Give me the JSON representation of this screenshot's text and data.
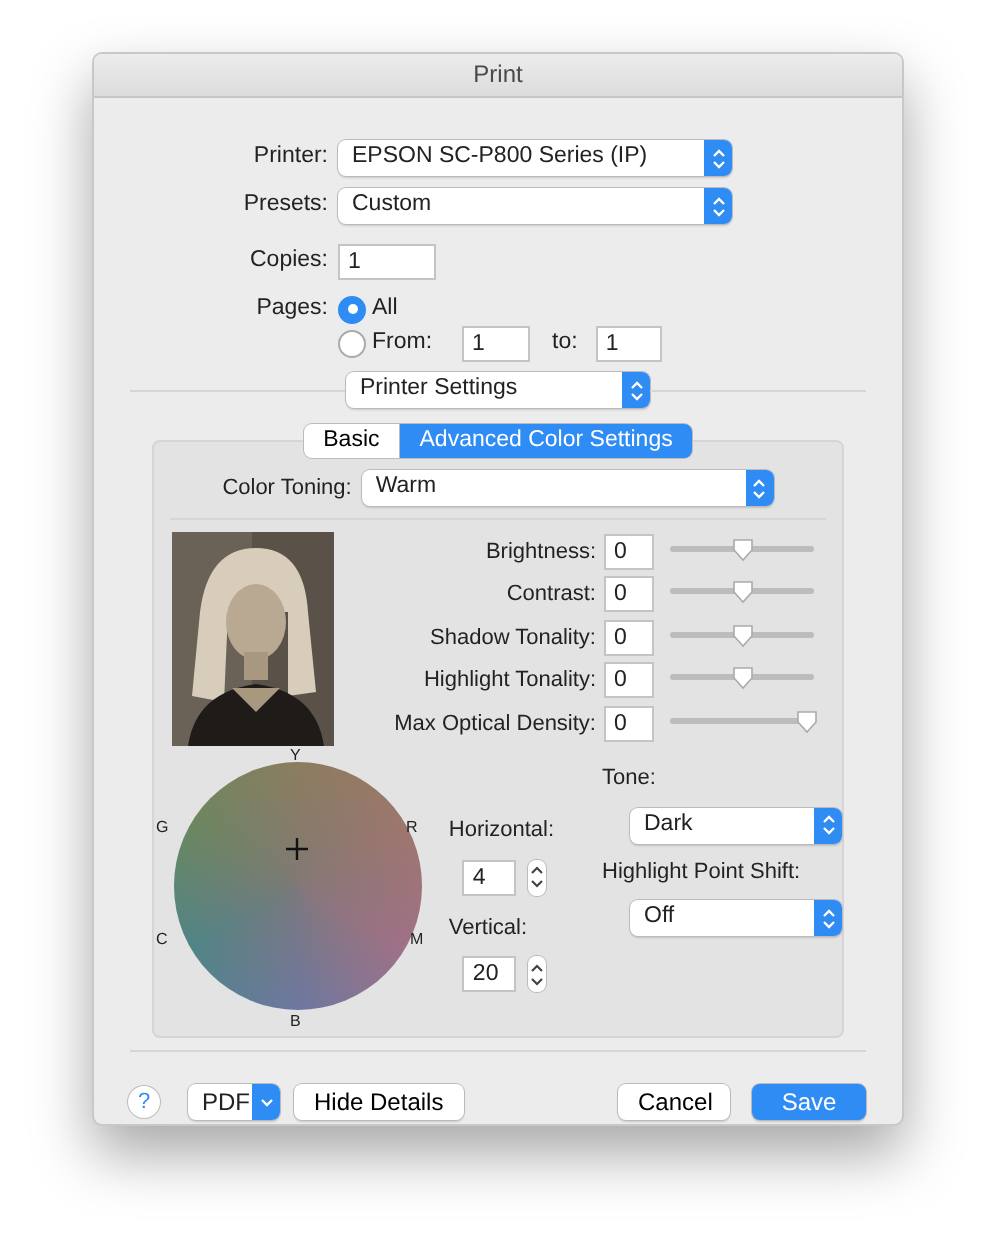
{
  "window": {
    "title": "Print"
  },
  "printer": {
    "label": "Printer:",
    "value": "EPSON SC-P800 Series (IP)"
  },
  "presets": {
    "label": "Presets:",
    "value": "Custom"
  },
  "copies": {
    "label": "Copies:",
    "value": "1"
  },
  "pages": {
    "label": "Pages:",
    "options": [
      {
        "label": "All",
        "selected": true
      },
      {
        "label": "From:",
        "selected": false
      }
    ],
    "from": "1",
    "to_label": "to:",
    "to": "1"
  },
  "section_menu": {
    "value": "Printer Settings"
  },
  "tabs": [
    {
      "label": "Basic",
      "selected": false
    },
    {
      "label": "Advanced Color Settings",
      "selected": true
    }
  ],
  "color_toning": {
    "label": "Color Toning:",
    "value": "Warm"
  },
  "adjustments": [
    {
      "label": "Brightness:",
      "value": "0",
      "level": 0.5
    },
    {
      "label": "Contrast:",
      "value": "0",
      "level": 0.5
    },
    {
      "label": "Shadow Tonality:",
      "value": "0",
      "level": 0.5
    },
    {
      "label": "Highlight Tonality:",
      "value": "0",
      "level": 0.5
    },
    {
      "label": "Max Optical Density:",
      "value": "0",
      "level": 0.95
    }
  ],
  "color_wheel": {
    "top": "Y",
    "upper_left": "G",
    "upper_right": "R",
    "lower_left": "C",
    "lower_right": "M",
    "bottom": "B"
  },
  "horizontal": {
    "label": "Horizontal:",
    "value": "4"
  },
  "vertical": {
    "label": "Vertical:",
    "value": "20"
  },
  "tone": {
    "label": "Tone:",
    "value": "Dark"
  },
  "highlight_point_shift": {
    "label": "Highlight Point Shift:",
    "value": "Off"
  },
  "footer": {
    "help": "?",
    "pdf": "PDF",
    "hide_details": "Hide Details",
    "cancel": "Cancel",
    "save": "Save"
  }
}
